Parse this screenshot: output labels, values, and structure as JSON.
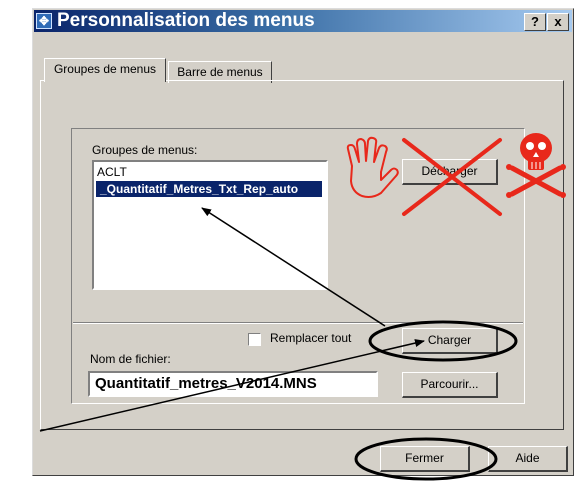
{
  "window": {
    "title": "Personnalisation des menus",
    "help_button": "?",
    "close_button": "x"
  },
  "tabs": [
    {
      "label": "Groupes de menus",
      "active": true
    },
    {
      "label": "Barre de menus",
      "active": false
    }
  ],
  "groups": {
    "label": "Groupes de menus:",
    "items": [
      {
        "label": "ACLT",
        "selected": false
      },
      {
        "label": "_Quantitatif_Metres_Txt_Rep_auto",
        "selected": true
      }
    ],
    "unload_button": "Décharger"
  },
  "file": {
    "replace_all_label": "Remplacer tout",
    "replace_all_checked": false,
    "load_button": "Charger",
    "filename_label": "Nom de fichier:",
    "filename_value": "Quantitatif_metres_V2014.MNS",
    "browse_button": "Parcourir..."
  },
  "footer": {
    "close_button": "Fermer",
    "help_button": "Aide"
  },
  "annotations": {
    "hand_icon": "stop-hand-icon",
    "cross_color": "#e8281b",
    "skull_icon": "skull-crossbones-icon",
    "circle_color": "#000000"
  }
}
